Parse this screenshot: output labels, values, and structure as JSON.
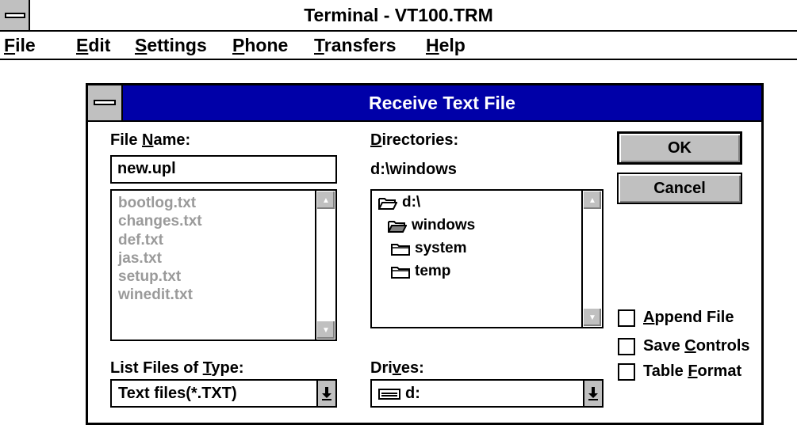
{
  "window": {
    "title": "Terminal - VT100.TRM"
  },
  "menu": [
    {
      "pre": "",
      "key": "F",
      "post": "ile"
    },
    {
      "pre": "",
      "key": "E",
      "post": "dit"
    },
    {
      "pre": "",
      "key": "S",
      "post": "ettings"
    },
    {
      "pre": "",
      "key": "P",
      "post": "hone"
    },
    {
      "pre": "",
      "key": "T",
      "post": "ransfers"
    },
    {
      "pre": "",
      "key": "H",
      "post": "elp"
    }
  ],
  "dialog": {
    "title": "Receive Text File",
    "file_name_label": {
      "pre": "File ",
      "key": "N",
      "post": "ame:"
    },
    "file_name_value": "new.upl",
    "files": [
      "bootlog.txt",
      "changes.txt",
      "def.txt",
      "jas.txt",
      "setup.txt",
      "winedit.txt"
    ],
    "directories_label": {
      "pre": "",
      "key": "D",
      "post": "irectories:"
    },
    "current_dir": "d:\\windows",
    "dirs": [
      {
        "name": "d:\\",
        "state": "open"
      },
      {
        "name": "windows",
        "state": "open-selected"
      },
      {
        "name": "system",
        "state": "closed"
      },
      {
        "name": "temp",
        "state": "closed"
      }
    ],
    "type_label": {
      "pre": "List Files of ",
      "key": "T",
      "post": "ype:"
    },
    "type_value": "Text files(*.TXT)",
    "drives_label": {
      "pre": "Dri",
      "key": "v",
      "post": "es:"
    },
    "drive_value": "d:",
    "ok_label": "OK",
    "cancel_label": "Cancel",
    "checkboxes": [
      {
        "pre": "",
        "key": "A",
        "post": "ppend File",
        "checked": false
      },
      {
        "pre": "Save ",
        "key": "C",
        "post": "ontrols",
        "checked": false
      },
      {
        "pre": "Table ",
        "key": "F",
        "post": "ormat",
        "checked": false
      }
    ]
  },
  "colors": {
    "dialog_titlebar": "#0000a8",
    "button_face": "#c0c0c0",
    "disabled_text": "#9a9a9a"
  }
}
